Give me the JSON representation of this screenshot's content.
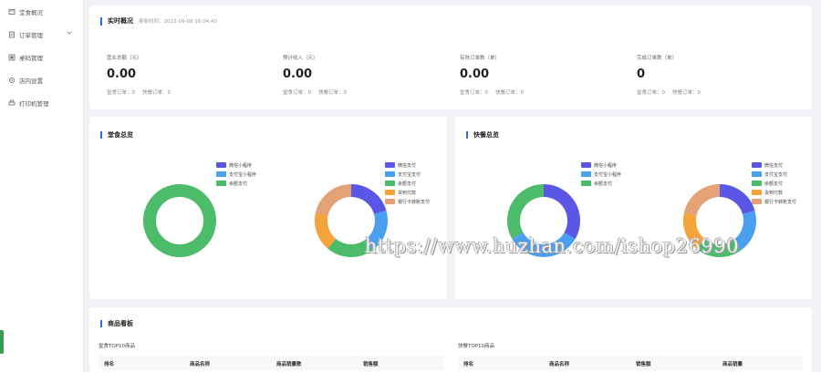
{
  "sidebar": {
    "items": [
      {
        "label": "堂食概况",
        "icon": "home-icon"
      },
      {
        "label": "订单管理",
        "icon": "order-icon",
        "expandable": true
      },
      {
        "label": "桌码管理",
        "icon": "qrcode-icon"
      },
      {
        "label": "店内设置",
        "icon": "settings-icon"
      },
      {
        "label": "打印机管理",
        "icon": "printer-icon"
      }
    ],
    "accent_color": "#3c9b53"
  },
  "overview": {
    "title": "实时概况",
    "update_time": "更新时间：2022-09-08 16:04:40",
    "stats": [
      {
        "label": "营业总额（元）",
        "value": "0.00",
        "sub1": "堂食订单：0",
        "sub2": "快餐订单：0"
      },
      {
        "label": "预计收入（元）",
        "value": "0.00",
        "sub1": "堂食订单：0",
        "sub2": "快餐订单：0"
      },
      {
        "label": "有效订单数（单）",
        "value": "0.00",
        "sub1": "堂食订单：0",
        "sub2": "快餐订单：0"
      },
      {
        "label": "完成订单数（单）",
        "value": "0",
        "sub1": "堂食订单：0",
        "sub2": "快餐订单：0"
      }
    ]
  },
  "dinein_panel": {
    "title": "堂食总览",
    "legend1": [
      "微信小程序",
      "支付宝小程序",
      "余额支付"
    ],
    "legend2": [
      "微信支付",
      "支付宝支付",
      "余额支付",
      "货到付款",
      "银行卡转账支付"
    ]
  },
  "fastfood_panel": {
    "title": "快餐总览",
    "legend1": [
      "微信小程序",
      "支付宝小程序",
      "余额支付"
    ],
    "legend2": [
      "微信支付",
      "支付宝支付",
      "余额支付",
      "货到付款",
      "银行卡转账支付"
    ]
  },
  "sales_board": {
    "title": "商品看板",
    "left_sub": "堂食TOP10商品",
    "right_sub": "快餐TOP10商品",
    "left_columns": [
      "排名",
      "商品名称",
      "商品销量数",
      "销售额"
    ],
    "right_columns": [
      "排名",
      "商品名称",
      "销售额",
      "商品销量"
    ]
  },
  "colors": {
    "purple": "#5b57e6",
    "blue": "#4b9ff0",
    "green": "#4cbc6a",
    "orange": "#f5a43c",
    "tan": "#e5a276",
    "accent": "#2d6bf5"
  },
  "watermark": "https://www.huzhan.com/ishop26990"
}
